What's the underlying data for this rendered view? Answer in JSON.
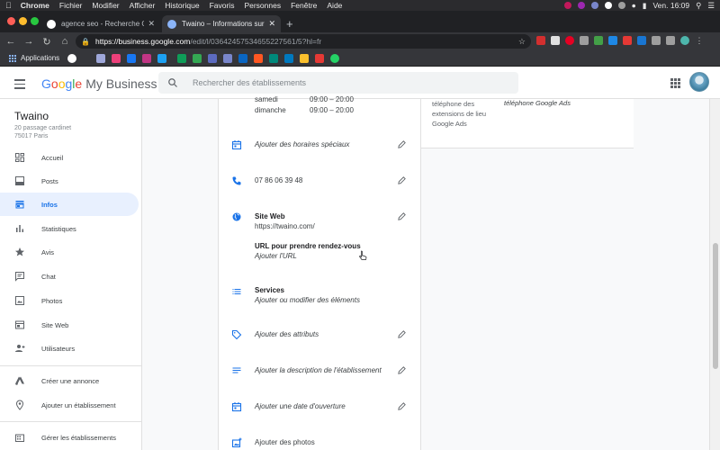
{
  "macos": {
    "menu": [
      "Chrome",
      "Fichier",
      "Modifier",
      "Afficher",
      "Historique",
      "Favoris",
      "Personnes",
      "Fenêtre",
      "Aide"
    ],
    "clock": "Ven. 16:09"
  },
  "browser": {
    "tabs": [
      {
        "title": "agence seo - Recherche Google",
        "favicon_color": "#ffffff",
        "active": false
      },
      {
        "title": "Twaino – Informations sur l'entreprise",
        "favicon_color": "#8ab4f8",
        "active": true
      }
    ],
    "url_host": "https://business.google.com",
    "url_path": "/edit/l/03642457534655227561/5?hl=fr",
    "bookmarks_label": "Applications"
  },
  "header": {
    "logo_google": [
      "G",
      "o",
      "o",
      "g",
      "l",
      "e"
    ],
    "logo_product": "My Business",
    "search_placeholder": "Rechercher des établissements"
  },
  "business": {
    "name": "Twaino",
    "address_line1": "20 passage cardinet",
    "address_line2": "75017 Paris"
  },
  "sidebar": {
    "items": [
      {
        "label": "Accueil",
        "icon": "dashboard-icon"
      },
      {
        "label": "Posts",
        "icon": "posts-icon"
      },
      {
        "label": "Infos",
        "icon": "storefront-icon",
        "active": true
      },
      {
        "label": "Statistiques",
        "icon": "bar-chart-icon"
      },
      {
        "label": "Avis",
        "icon": "star-icon"
      },
      {
        "label": "Chat",
        "icon": "chat-icon"
      },
      {
        "label": "Photos",
        "icon": "photo-icon"
      },
      {
        "label": "Site Web",
        "icon": "website-icon"
      },
      {
        "label": "Utilisateurs",
        "icon": "add-user-icon"
      }
    ],
    "bottom_items": [
      {
        "label": "Créer une annonce",
        "icon": "ads-icon"
      },
      {
        "label": "Ajouter un établissement",
        "icon": "location-pin-icon"
      },
      {
        "label": "Gérer les établissements",
        "icon": "building-icon"
      }
    ]
  },
  "info": {
    "hours": [
      {
        "day": "samedi",
        "time": "09:00 – 20:00"
      },
      {
        "day": "dimanche",
        "time": "09:00 – 20:00"
      }
    ],
    "special_hours": "Ajouter des horaires spéciaux",
    "phone": "07 86 06 39 48",
    "website_title": "Site Web",
    "website_url": "https://twaino.com/",
    "appointment_title": "URL pour prendre rendez-vous",
    "appointment_value": "Ajouter l'URL",
    "services_title": "Services",
    "services_value": "Ajouter ou modifier des éléments",
    "attributes": "Ajouter des attributs",
    "description": "Ajouter la description de l'établissement",
    "opening_date": "Ajouter une date d'ouverture",
    "photos": "Ajouter des photos"
  },
  "right_panel": {
    "label_lines": [
      "téléphone des",
      "extensions de lieu",
      "Google Ads"
    ],
    "value": "téléphone Google Ads"
  },
  "colors": {
    "accent": "#1a73e8",
    "active_bg": "#e8f0fe",
    "icon_gray": "#5f6368"
  }
}
